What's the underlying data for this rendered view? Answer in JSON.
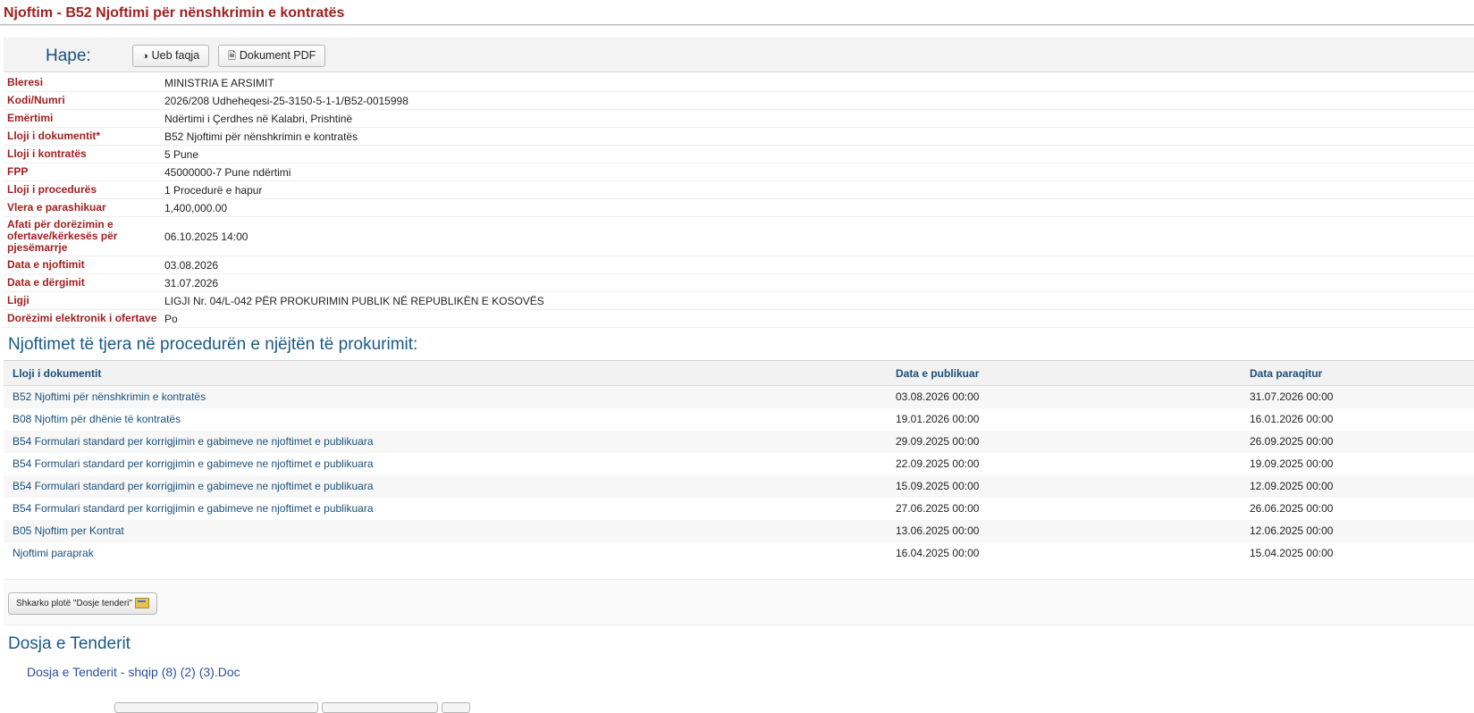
{
  "page": {
    "title": "Njoftim - B52 Njoftimi për nënshkrimin e kontratës"
  },
  "open_bar": {
    "label": "Hape:",
    "web_button": "Ueb faqja",
    "pdf_button": "Dokument PDF"
  },
  "details": [
    {
      "label": "Bleresi",
      "value": "MINISTRIA E ARSIMIT"
    },
    {
      "label": "Kodi/Numri",
      "value": "2026/208 Udheheqesi-25-3150-5-1-1/B52-0015998"
    },
    {
      "label": "Emërtimi",
      "value": "Ndërtimi i Çerdhes në Kalabri, Prishtinë"
    },
    {
      "label": "Lloji i dokumentit*",
      "value": "B52 Njoftimi për nënshkrimin e kontratës"
    },
    {
      "label": "Lloji i kontratës",
      "value": "5 Pune"
    },
    {
      "label": "FPP",
      "value": "45000000-7 Pune ndërtimi"
    },
    {
      "label": "Lloji i procedurës",
      "value": "1 Procedurë e hapur"
    },
    {
      "label": "Vlera e parashikuar",
      "value": "1,400,000.00"
    },
    {
      "label": "Afati për dorëzimin e ofertave/kërkesës për pjesëmarrje",
      "value": "06.10.2025 14:00"
    },
    {
      "label": "Data e njoftimit",
      "value": "03.08.2026"
    },
    {
      "label": "Data e dërgimit",
      "value": "31.07.2026"
    },
    {
      "label": "Ligji",
      "value": "LIGJI Nr. 04/L-042 PËR PROKURIMIN PUBLIK NË REPUBLIKËN E KOSOVËS"
    },
    {
      "label": "Dorëzimi elektronik i ofertave",
      "value": "Po"
    }
  ],
  "notices": {
    "title": "Njoftimet të tjera në procedurën e njëjtën të prokurimit:",
    "columns": [
      "Lloji i dokumentit",
      "Data e publikuar",
      "Data paraqitur"
    ],
    "rows": [
      {
        "doc": "B52 Njoftimi për nënshkrimin e kontratës",
        "published": "03.08.2026 00:00",
        "submitted": "31.07.2026 00:00"
      },
      {
        "doc": "B08 Njoftim për dhënie të kontratës",
        "published": "19.01.2026 00:00",
        "submitted": "16.01.2026 00:00"
      },
      {
        "doc": "B54 Formulari standard per korrigjimin e gabimeve ne njoftimet e publikuara",
        "published": "29.09.2025 00:00",
        "submitted": "26.09.2025 00:00"
      },
      {
        "doc": "B54 Formulari standard per korrigjimin e gabimeve ne njoftimet e publikuara",
        "published": "22.09.2025 00:00",
        "submitted": "19.09.2025 00:00"
      },
      {
        "doc": "B54 Formulari standard per korrigjimin e gabimeve ne njoftimet e publikuara",
        "published": "15.09.2025 00:00",
        "submitted": "12.09.2025 00:00"
      },
      {
        "doc": "B54 Formulari standard per korrigjimin e gabimeve ne njoftimet e publikuara",
        "published": "27.06.2025 00:00",
        "submitted": "26.06.2025 00:00"
      },
      {
        "doc": "B05 Njoftim per Kontrat",
        "published": "13.06.2025 00:00",
        "submitted": "12.06.2025 00:00"
      },
      {
        "doc": "Njoftimi paraprak",
        "published": "16.04.2025 00:00",
        "submitted": "15.04.2025 00:00"
      }
    ]
  },
  "download": {
    "button_label": "Shkarko plotë \"Dosje tenderi\""
  },
  "tender": {
    "title": "Dosja e Tenderit",
    "file": "Dosja e Tenderit - shqip (8) (2) (3).Doc"
  },
  "icons": {
    "web": "globe-icon",
    "pdf": "pdf-file-icon",
    "download": "folder-zip-icon"
  },
  "colors": {
    "title_red": "#a02020",
    "label_red": "#a02020",
    "link_blue": "#1a4f7a",
    "heading_blue": "#1a5a86"
  }
}
